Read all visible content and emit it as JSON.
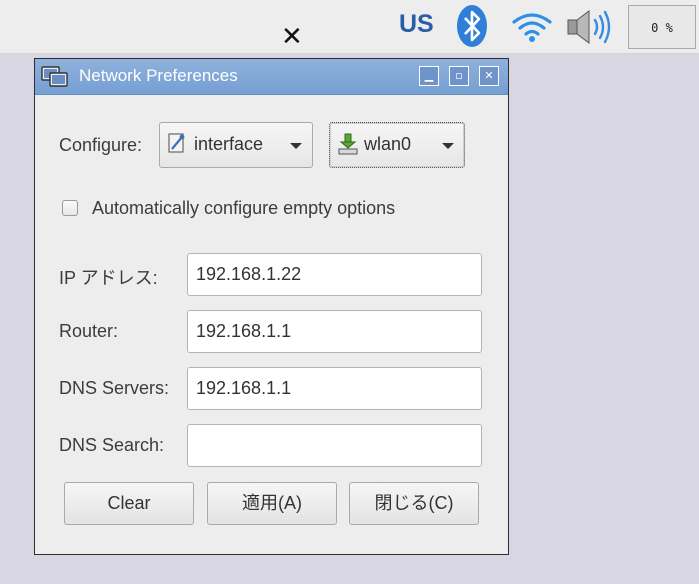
{
  "taskbar": {
    "close_glyph": "✕",
    "keyboard_layout": "US",
    "bluetooth_icon": "bluetooth-icon",
    "wifi_icon": "wifi-icon",
    "volume_icon": "volume-icon",
    "cpu_usage": "0 %"
  },
  "window": {
    "title": "Network Preferences",
    "controls": {
      "minimize": "▁",
      "maximize": "▫",
      "close": "✕"
    }
  },
  "configure": {
    "label": "Configure:",
    "type_value": "interface",
    "device_value": "wlan0"
  },
  "auto_configure": {
    "label": "Automatically configure empty options",
    "checked": false
  },
  "fields": {
    "ip_label": "IP アドレス:",
    "ip_value": "192.168.1.22",
    "router_label": "Router:",
    "router_value": "192.168.1.1",
    "dns_servers_label": "DNS Servers:",
    "dns_servers_value": "192.168.1.1",
    "dns_search_label": "DNS Search:",
    "dns_search_value": ""
  },
  "buttons": {
    "clear": "Clear",
    "apply": "適用(A)",
    "close": "閉じる(C)"
  },
  "colors": {
    "titlebar": "#7ea5d6",
    "window_bg": "#ededed",
    "desktop_bg": "#d8d6e2",
    "keyboard_layout_text": "#2a5da8",
    "bluetooth": "#2f7fd8"
  }
}
